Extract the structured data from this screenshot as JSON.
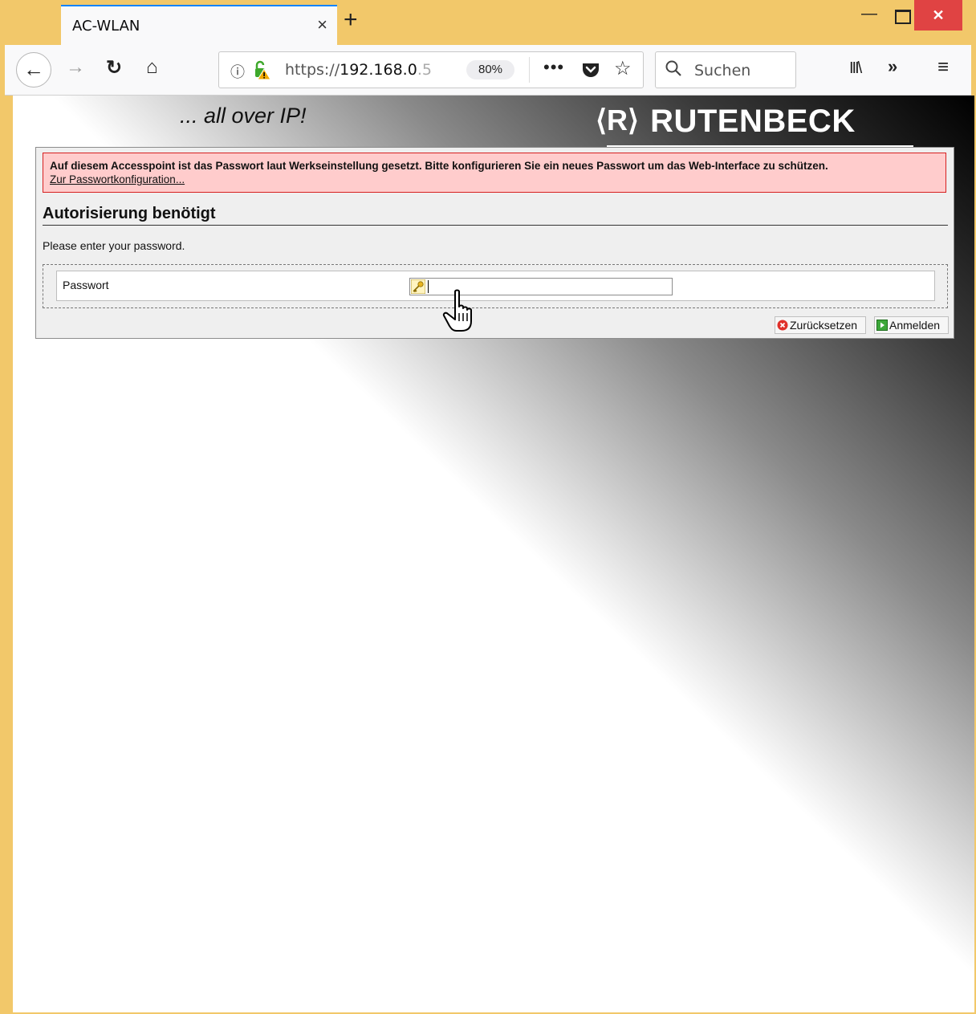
{
  "window": {
    "tab_title": "AC-WLAN",
    "close_tab_glyph": "×",
    "new_tab_glyph": "+",
    "minimize_glyph": "—",
    "close_glyph": "✕"
  },
  "toolbar": {
    "back_glyph": "←",
    "forward_glyph": "→",
    "reload_glyph": "↻",
    "home_glyph": "⌂",
    "url_scheme": "https://",
    "url_host": "192.168.0",
    "url_rest": ".5",
    "zoom": "80%",
    "more_glyph": "•••",
    "star_glyph": "☆",
    "search_placeholder": "Suchen",
    "library_glyph": "III\\",
    "overflow_glyph": "»",
    "menu_glyph": "≡",
    "info_glyph": "ⓘ"
  },
  "page": {
    "tagline": "... all over IP!",
    "logo_mark": "⟨R⟩",
    "logo_text": "RUTENBECK",
    "alert_text": "Auf diesem Accesspoint ist das Passwort laut Werkseinstellung gesetzt. Bitte konfigurieren Sie ein neues Passwort um das Web-Interface zu schützen.",
    "alert_link": "Zur Passwortkonfiguration...",
    "heading": "Autorisierung benötigt",
    "intro": "Please enter your password.",
    "password_label": "Passwort",
    "password_value": "",
    "reset_button": "Zurücksetzen",
    "login_button": "Anmelden"
  },
  "colors": {
    "titlebar": "#f2c86a",
    "tab_accent": "#0a84ff",
    "alert_bg": "#ffcccc",
    "alert_border": "#d62020",
    "close_button": "#e04343"
  },
  "icons": [
    "info-icon",
    "lock-warning-icon",
    "pocket-icon",
    "star-icon",
    "search-icon",
    "library-icon",
    "key-icon",
    "reset-icon",
    "login-icon",
    "hand-cursor-icon"
  ]
}
